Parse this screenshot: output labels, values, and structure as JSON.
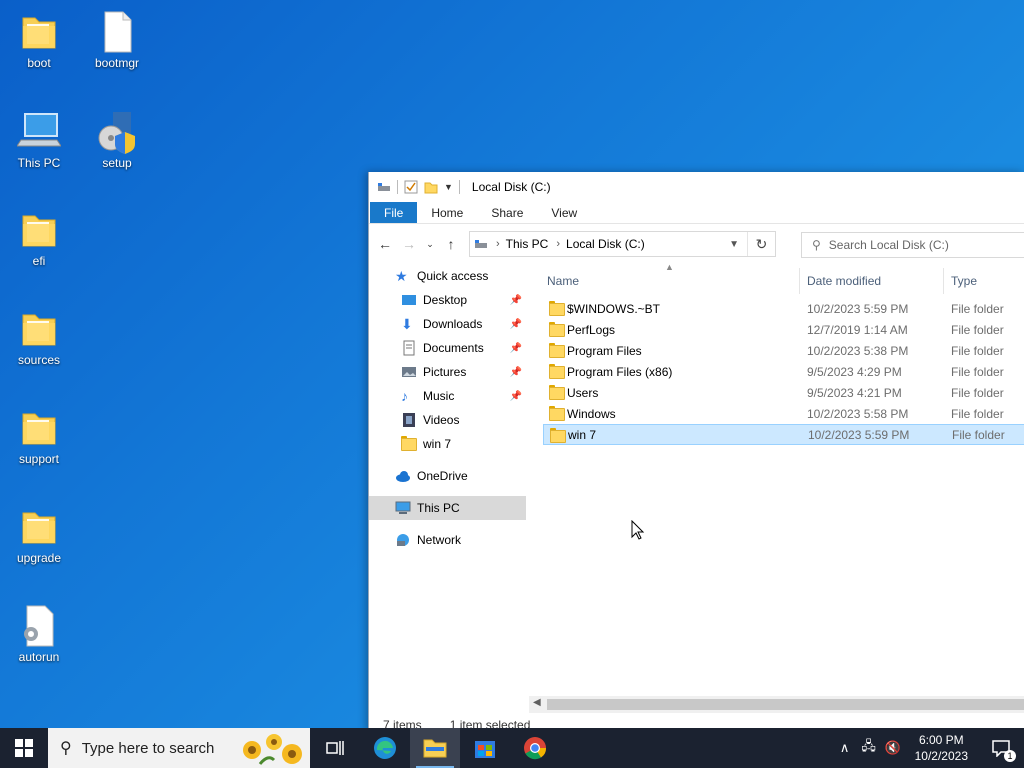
{
  "desktop": {
    "icons": [
      {
        "label": "boot"
      },
      {
        "label": "bootmgr"
      },
      {
        "label": "This PC"
      },
      {
        "label": "setup"
      },
      {
        "label": "efi"
      },
      {
        "label": "sources"
      },
      {
        "label": "support"
      },
      {
        "label": "upgrade"
      },
      {
        "label": "autorun"
      }
    ]
  },
  "explorer": {
    "title": "Local Disk (C:)",
    "ribbon_tabs": [
      "File",
      "Home",
      "Share",
      "View"
    ],
    "address": {
      "segments": [
        "This PC",
        "Local Disk (C:)"
      ]
    },
    "search_placeholder": "Search Local Disk (C:)",
    "nav": {
      "quick_access": "Quick access",
      "items": [
        {
          "label": "Desktop",
          "pinned": true
        },
        {
          "label": "Downloads",
          "pinned": true
        },
        {
          "label": "Documents",
          "pinned": true
        },
        {
          "label": "Pictures",
          "pinned": true
        },
        {
          "label": "Music",
          "pinned": true
        },
        {
          "label": "Videos",
          "pinned": false
        },
        {
          "label": "win 7",
          "pinned": false
        }
      ],
      "onedrive": "OneDrive",
      "this_pc": "This PC",
      "network": "Network"
    },
    "columns": {
      "name": "Name",
      "date": "Date modified",
      "type": "Type"
    },
    "rows": [
      {
        "name": "$WINDOWS.~BT",
        "date": "10/2/2023 5:59 PM",
        "type": "File folder"
      },
      {
        "name": "PerfLogs",
        "date": "12/7/2019 1:14 AM",
        "type": "File folder"
      },
      {
        "name": "Program Files",
        "date": "10/2/2023 5:38 PM",
        "type": "File folder"
      },
      {
        "name": "Program Files (x86)",
        "date": "9/5/2023 4:29 PM",
        "type": "File folder"
      },
      {
        "name": "Users",
        "date": "9/5/2023 4:21 PM",
        "type": "File folder"
      },
      {
        "name": "Windows",
        "date": "10/2/2023 5:58 PM",
        "type": "File folder"
      },
      {
        "name": "win 7",
        "date": "10/2/2023 5:59 PM",
        "type": "File folder"
      }
    ],
    "status": {
      "items": "7 items",
      "selected": "1 item selected"
    }
  },
  "taskbar": {
    "search_placeholder": "Type here to search",
    "time": "6:00 PM",
    "date": "10/2/2023",
    "notification_count": "1"
  },
  "colors": {
    "accent": "#1979ca",
    "selection": "#cce8ff",
    "taskbar": "#1b2230"
  }
}
